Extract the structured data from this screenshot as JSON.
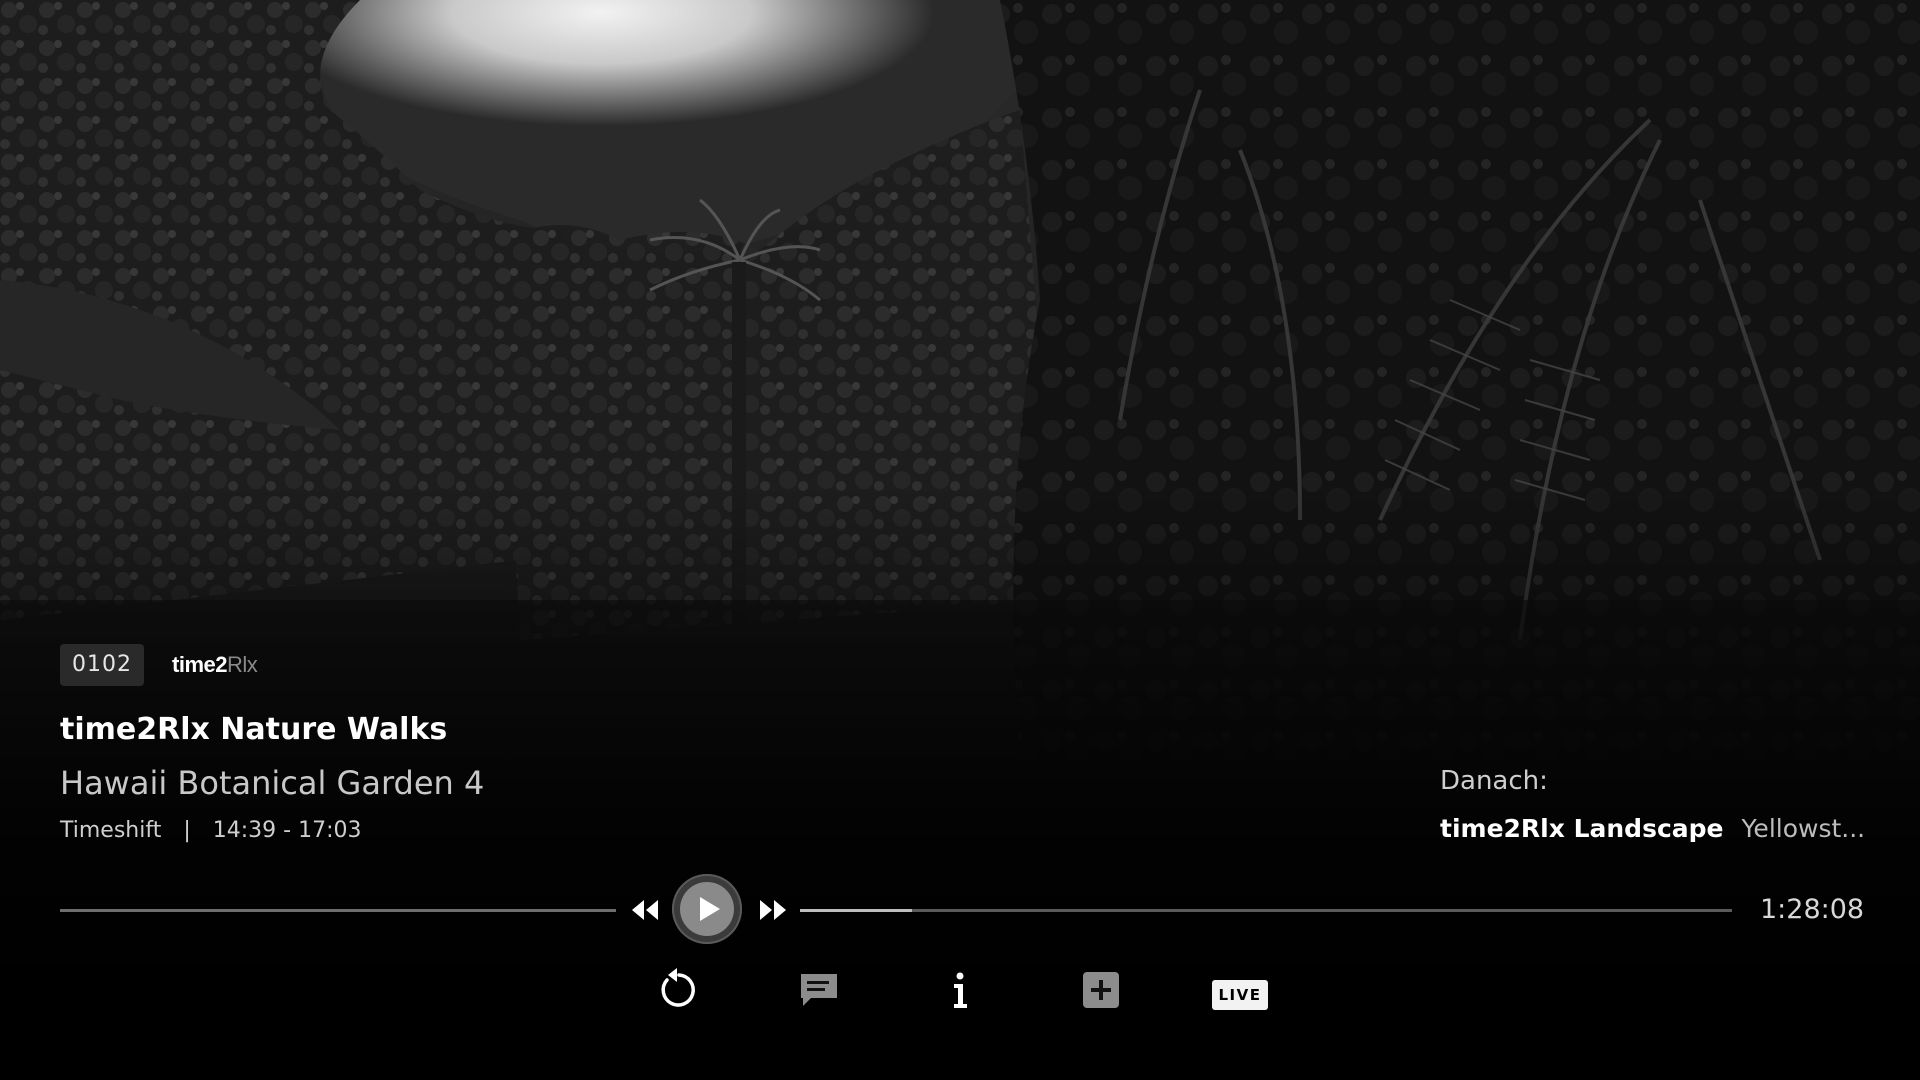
{
  "player": {
    "channel_number": "0102",
    "channel_logo": {
      "main": "time2",
      "thin": "Rlx"
    },
    "show_title": "time2Rlx Nature Walks",
    "episode_title": "Hawaii Botanical Garden 4",
    "mode": "Timeshift",
    "separator": "|",
    "time_slot": "14:39 - 17:03",
    "time_remaining": "1:28:08",
    "progress_fraction": 0.12
  },
  "up_next": {
    "label": "Danach:",
    "title": "time2Rlx Landscape",
    "subtitle": "Yellowst..."
  },
  "transport": {
    "rewind_icon": "rewind-icon",
    "play_icon": "play-icon",
    "forward_icon": "fast-forward-icon"
  },
  "actions": {
    "restart_icon": "restart-icon",
    "subtitles_icon": "subtitles-icon",
    "info_icon": "info-icon",
    "add_icon": "add-icon",
    "live_label": "LIVE"
  }
}
